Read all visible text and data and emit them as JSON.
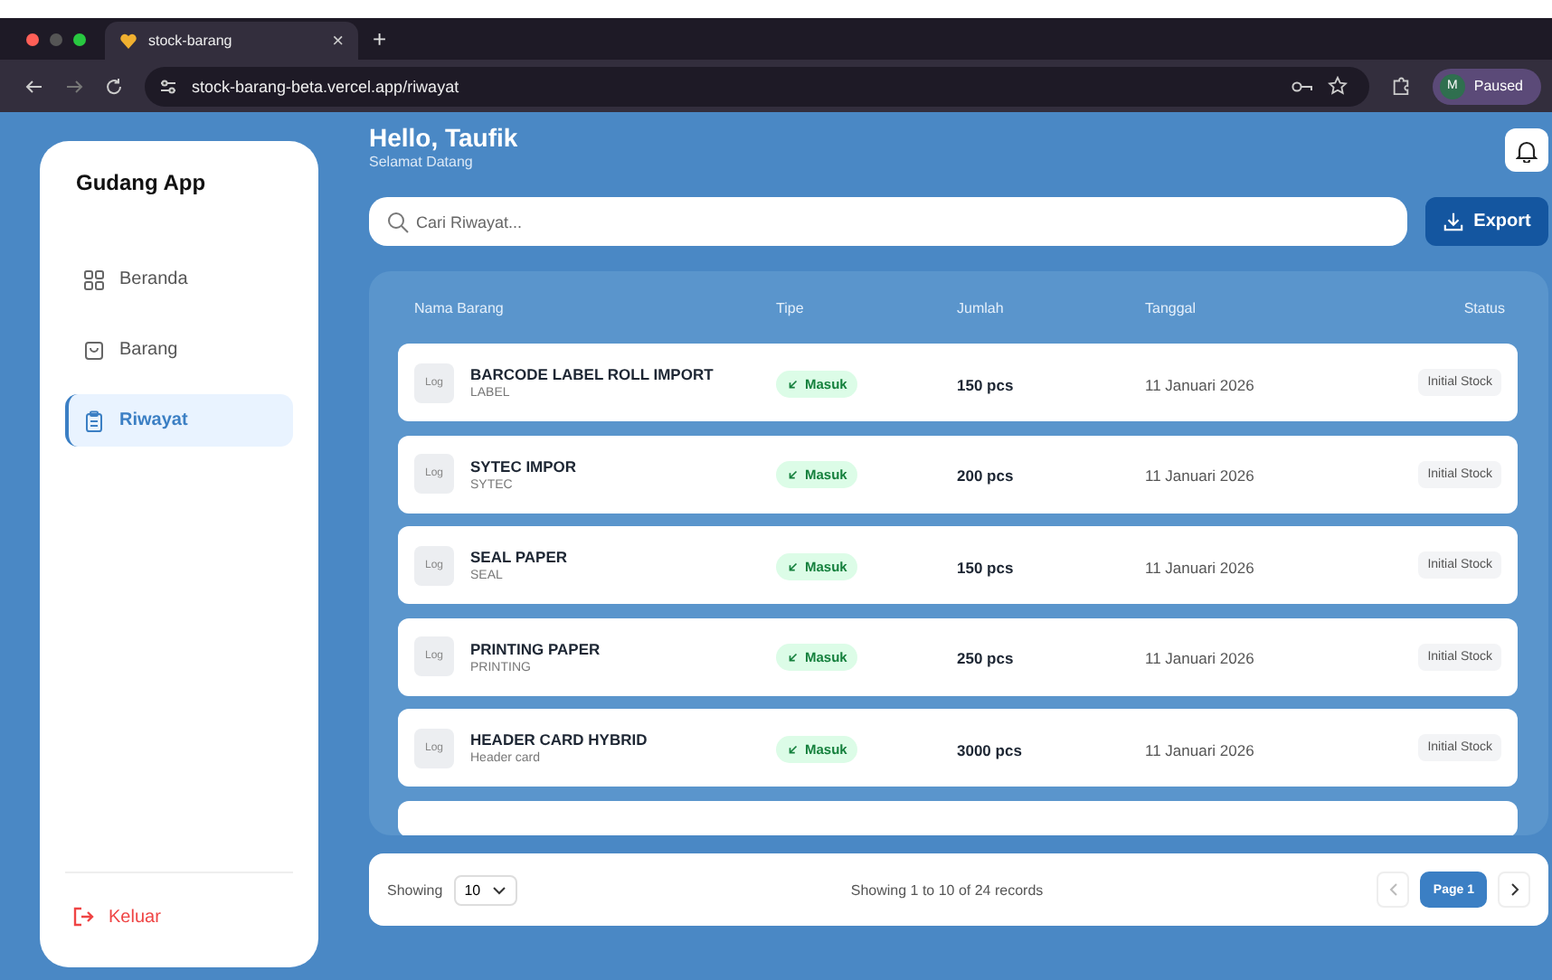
{
  "browser": {
    "tab_title": "stock-barang",
    "tab_close": "×",
    "new_tab": "+",
    "url": "stock-barang-beta.vercel.app/riwayat",
    "profile_initial": "M",
    "profile_status": "Paused"
  },
  "sidebar": {
    "app_name": "Gudang App",
    "items": [
      {
        "label": "Beranda",
        "selected": false
      },
      {
        "label": "Barang",
        "selected": false
      },
      {
        "label": "Riwayat",
        "selected": true
      }
    ],
    "logout": "Keluar"
  },
  "header": {
    "greeting": "Hello, Taufik",
    "subtitle": "Selamat Datang"
  },
  "search": {
    "placeholder": "Cari Riwayat..."
  },
  "export_button": "Export",
  "table": {
    "columns": [
      "Nama Barang",
      "Tipe",
      "Jumlah",
      "Tanggal",
      "Status"
    ],
    "rows": [
      {
        "thumb": "Log",
        "name": "BARCODE LABEL ROLL IMPORT",
        "category": "LABEL",
        "type": "Masuk",
        "kind": "in",
        "qty": "150 pcs",
        "date": "11 Januari 2026",
        "status": "Initial Stock"
      },
      {
        "thumb": "Log",
        "name": "SYTEC IMPOR",
        "category": "SYTEC",
        "type": "Masuk",
        "kind": "in",
        "qty": "200 pcs",
        "date": "11 Januari 2026",
        "status": "Initial Stock"
      },
      {
        "thumb": "Log",
        "name": "SEAL PAPER",
        "category": "SEAL",
        "type": "Masuk",
        "kind": "in",
        "qty": "150 pcs",
        "date": "11 Januari 2026",
        "status": "Initial Stock"
      },
      {
        "thumb": "Log",
        "name": "PRINTING PAPER",
        "category": "PRINTING",
        "type": "Masuk",
        "kind": "in",
        "qty": "250 pcs",
        "date": "11 Januari 2026",
        "status": "Initial Stock"
      },
      {
        "thumb": "Log",
        "name": "HEADER CARD HYBRID",
        "category": "Header card",
        "type": "Masuk",
        "kind": "in",
        "qty": "3000 pcs",
        "date": "11 Januari 2026",
        "status": "Initial Stock"
      }
    ]
  },
  "pagination": {
    "showing_label": "Showing",
    "page_size": "10",
    "summary": "Showing 1 to 10 of 24 records",
    "page": "Page 1"
  }
}
